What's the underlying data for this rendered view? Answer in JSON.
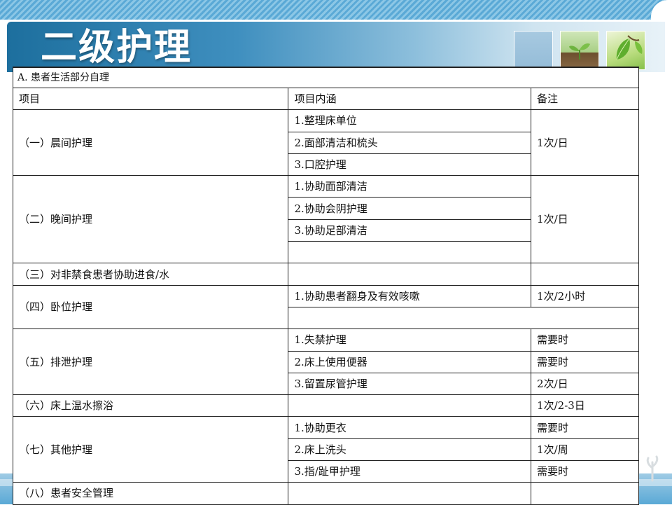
{
  "title": "二级护理",
  "section_label": "A. 患者生活部分自理",
  "headers": [
    "项目",
    "项目内涵",
    "备注"
  ],
  "groups": [
    {
      "item": "（一）晨间护理",
      "contents": [
        "1.整理床单位",
        "2.面部清洁和梳头",
        "3.口腔护理"
      ],
      "note": "1次/日"
    },
    {
      "item": "（二）晚间护理",
      "contents": [
        "1.协助面部清洁",
        "2.协助会阴护理",
        "3.协助足部清洁",
        ""
      ],
      "note": "1次/日"
    },
    {
      "item": "（三）对非禁食患者协助进食/水",
      "contents": [
        ""
      ],
      "note": ""
    },
    {
      "item": "（四）卧位护理",
      "contents": [
        "1.协助患者翻身及有效咳嗽",
        ""
      ],
      "notes": [
        "1次/2小时",
        ""
      ]
    },
    {
      "item": "（五）排泄护理",
      "contents": [
        "1.失禁护理",
        "2.床上使用便器",
        "3.留置尿管护理"
      ],
      "notes": [
        "需要时",
        "需要时",
        "2次/日"
      ]
    },
    {
      "item": "（六）床上温水擦浴",
      "contents": [
        ""
      ],
      "note": "1次/2-3日"
    },
    {
      "item": "（七）其他护理",
      "contents": [
        "1.协助更衣",
        "2.床上洗头",
        "3.指/趾甲护理"
      ],
      "notes": [
        "需要时",
        "1次/周",
        "需要时"
      ]
    },
    {
      "item": "（八）患者安全管理",
      "contents": [
        ""
      ],
      "note": ""
    }
  ],
  "colors": {
    "banner": "#1d6f9e",
    "stripe": "#5aa9d6",
    "grid": "#222222"
  },
  "icons": [
    "sprout-icon",
    "leaf-icon",
    "plant-silhouette-icon"
  ]
}
